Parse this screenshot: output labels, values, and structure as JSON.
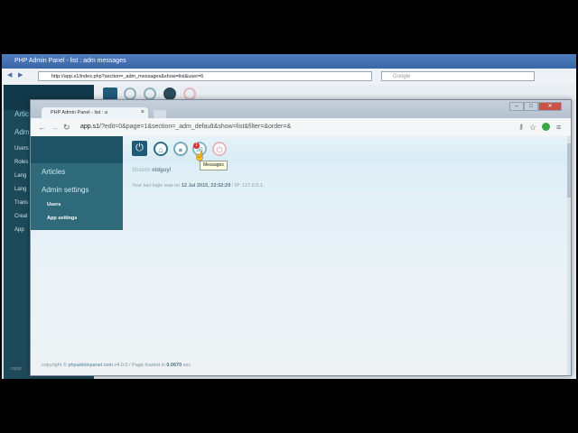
{
  "back_window": {
    "title": "PHP Admin Panel - list : adm messages",
    "url": "http://app.s1/index.php?section=_adm_messages&show=list&user=6",
    "search_placeholder": "Google",
    "sidebar": [
      {
        "label": "Artic",
        "big": true
      },
      {
        "label": "Adm",
        "big": true
      },
      {
        "label": "Users"
      },
      {
        "label": "Roles"
      },
      {
        "label": "Lang"
      },
      {
        "label": "Lang"
      },
      {
        "label": "Trans"
      },
      {
        "label": "Creat"
      },
      {
        "label": "App"
      }
    ],
    "footer_fragment": "copyr"
  },
  "front_window": {
    "tab_title": "PHP Admin Panel - list : a",
    "tab_close": "×",
    "url_host": "app.s1",
    "url_path": "/?edit=0&page=1&section=_adm_default&show=list&filter=&order=&",
    "sidebar": {
      "items": [
        {
          "label": "Articles"
        },
        {
          "label": "Admin settings"
        }
      ],
      "subitems": [
        {
          "label": "Users"
        },
        {
          "label": "App settings"
        }
      ]
    },
    "toolbar": {
      "badge_count": "1",
      "tooltip": "Messages"
    },
    "greeting": {
      "prefix": "Shalom ",
      "username": "oldguy!"
    },
    "last_login": {
      "prefix": "Your last login was on ",
      "datetime": "12 Jul 2015, 22:52:29",
      "ip_prefix": " / IP: ",
      "ip": "127.0.0.1."
    },
    "footer": {
      "prefix": "copyright © ",
      "site": "phpadminpanel.com",
      "version": " v4.0.0 / Page loaded in ",
      "time": "0.0670",
      "unit": " sec"
    }
  }
}
